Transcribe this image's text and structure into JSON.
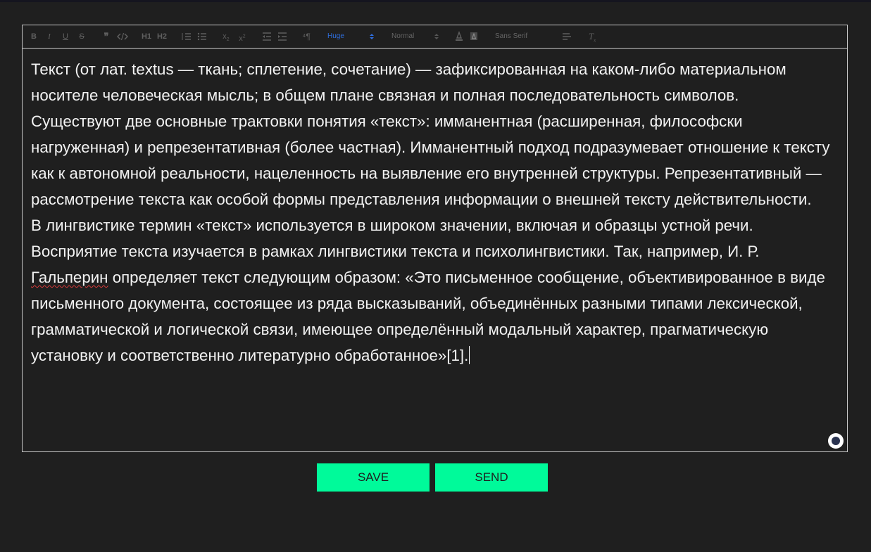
{
  "toolbar": {
    "header_picker_value": "Huge",
    "size_picker_value": "Normal",
    "font_picker_value": "Sans Serif",
    "header_1_label": "H1",
    "header_2_label": "H2",
    "active_color": "#2f6fe0"
  },
  "editor": {
    "paragraphs": [
      "Текст (от лат. textus — ткань; сплетение, сочетание) — зафиксированная на каком-либо материальном носителе человеческая мысль; в общем плане связная и полная последовательность символов.",
      "Существуют две основные трактовки понятия «текст»: имманентная (расширенная, философски нагруженная) и репрезентативная (более частная). Имманентный подход подразумевает отношение к тексту как к автономной реальности, нацеленность на выявление его внутренней структуры. Репрезентативный — рассмотрение текста как особой формы представления информации о внешней тексту действительности."
    ],
    "p3_before": "В лингвистике термин «текст» используется в широком значении, включая и образцы устной речи. Восприятие текста изучается в рамках лингвистики текста и психолингвистики. Так, например, И. Р. ",
    "p3_misspelled": "Гальперин",
    "p3_after": " определяет текст следующим образом: «Это письменное сообщение, объективированное в виде письменного документа, состоящее из ряда высказываний, объединённых разными типами лексической, грамматической и логической связи, имеющее определённый модальный характер, прагматическую установку и соответственно литературно обработанное»[1]."
  },
  "actions": {
    "save_label": "SAVE",
    "send_label": "SEND",
    "accent_color": "#00fa9a"
  },
  "theme": {
    "background": "#1f1f1f",
    "text_color": "#f2f2f2"
  }
}
